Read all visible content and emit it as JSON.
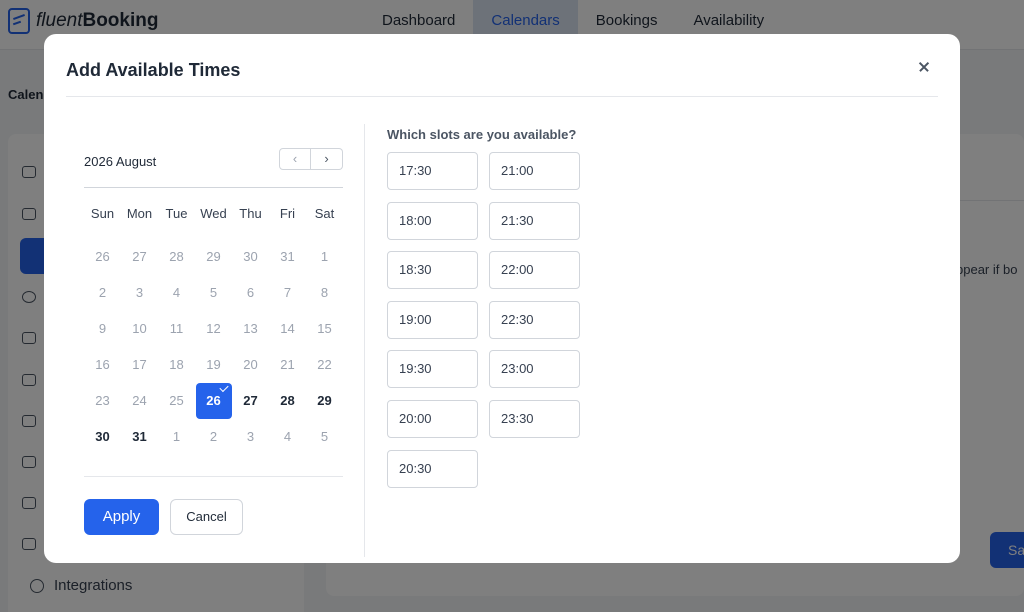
{
  "app": {
    "logo_light": "fluent",
    "logo_bold": "Booking",
    "nav": [
      {
        "label": "Dashboard"
      },
      {
        "label": "Calendars"
      },
      {
        "label": "Bookings"
      },
      {
        "label": "Availability"
      }
    ],
    "breadcrumb_partial": "Calen",
    "sidebar_bottom_label": "Integrations",
    "main_partial_text": "ppear if bo",
    "save_partial": "Sa",
    "accent_color": "#2563eb"
  },
  "modal": {
    "title": "Add Available Times",
    "close_icon": "close-icon",
    "calendar": {
      "month_label": "2026 August",
      "prev_icon": "chevron-left-icon",
      "next_icon": "chevron-right-icon",
      "weekdays": [
        "Sun",
        "Mon",
        "Tue",
        "Wed",
        "Thu",
        "Fri",
        "Sat"
      ],
      "weeks": [
        [
          {
            "d": "26",
            "enabled": false
          },
          {
            "d": "27",
            "enabled": false
          },
          {
            "d": "28",
            "enabled": false
          },
          {
            "d": "29",
            "enabled": false
          },
          {
            "d": "30",
            "enabled": false
          },
          {
            "d": "31",
            "enabled": false
          },
          {
            "d": "1",
            "enabled": false
          }
        ],
        [
          {
            "d": "2",
            "enabled": false
          },
          {
            "d": "3",
            "enabled": false
          },
          {
            "d": "4",
            "enabled": false
          },
          {
            "d": "5",
            "enabled": false
          },
          {
            "d": "6",
            "enabled": false
          },
          {
            "d": "7",
            "enabled": false
          },
          {
            "d": "8",
            "enabled": false
          }
        ],
        [
          {
            "d": "9",
            "enabled": false
          },
          {
            "d": "10",
            "enabled": false
          },
          {
            "d": "11",
            "enabled": false
          },
          {
            "d": "12",
            "enabled": false
          },
          {
            "d": "13",
            "enabled": false
          },
          {
            "d": "14",
            "enabled": false
          },
          {
            "d": "15",
            "enabled": false
          }
        ],
        [
          {
            "d": "16",
            "enabled": false
          },
          {
            "d": "17",
            "enabled": false
          },
          {
            "d": "18",
            "enabled": false
          },
          {
            "d": "19",
            "enabled": false
          },
          {
            "d": "20",
            "enabled": false
          },
          {
            "d": "21",
            "enabled": false
          },
          {
            "d": "22",
            "enabled": false
          }
        ],
        [
          {
            "d": "23",
            "enabled": false
          },
          {
            "d": "24",
            "enabled": false
          },
          {
            "d": "25",
            "enabled": false
          },
          {
            "d": "26",
            "enabled": true,
            "selected": true
          },
          {
            "d": "27",
            "enabled": true
          },
          {
            "d": "28",
            "enabled": true
          },
          {
            "d": "29",
            "enabled": true
          }
        ],
        [
          {
            "d": "30",
            "enabled": true
          },
          {
            "d": "31",
            "enabled": true
          },
          {
            "d": "1",
            "enabled": false
          },
          {
            "d": "2",
            "enabled": false
          },
          {
            "d": "3",
            "enabled": false
          },
          {
            "d": "4",
            "enabled": false
          },
          {
            "d": "5",
            "enabled": false
          }
        ]
      ]
    },
    "apply_label": "Apply",
    "cancel_label": "Cancel",
    "slots_title": "Which slots are you available?",
    "slots": [
      "17:30",
      "21:00",
      "18:00",
      "21:30",
      "18:30",
      "22:00",
      "19:00",
      "22:30",
      "19:30",
      "23:00",
      "20:00",
      "23:30",
      "20:30"
    ]
  }
}
